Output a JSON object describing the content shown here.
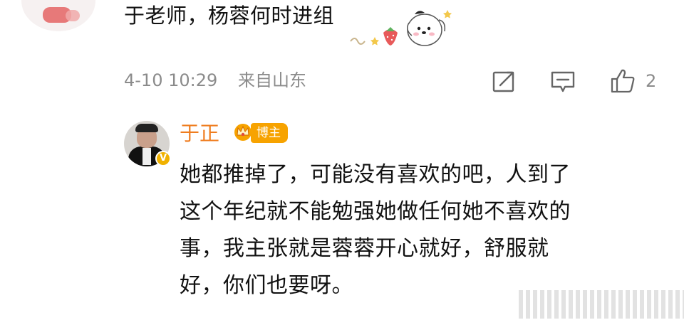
{
  "top_comment": {
    "text": "于老师，杨蓉何时进组",
    "time": "4-10 10:29",
    "location": "来自山东",
    "like_count": "2"
  },
  "reply": {
    "username": "于正",
    "badge": "博主",
    "text_lines": [
      "她都推掉了，可能没有喜欢的吧，人到了",
      "这个年纪就不能勉强她做任何她不喜欢的",
      "事，我主张就是蓉蓉开心就好，舒服就",
      "好，你们也要呀。"
    ]
  },
  "icons": {
    "share": "share-icon",
    "comment": "comment-icon",
    "like": "like-icon",
    "crown": "crown-icon",
    "verified": "verified-icon",
    "sticker": "puppy-sticker"
  },
  "colors": {
    "username": "#ef7d1f",
    "badge_bg": "#f7a300",
    "meta_text": "#8b8b8b"
  }
}
